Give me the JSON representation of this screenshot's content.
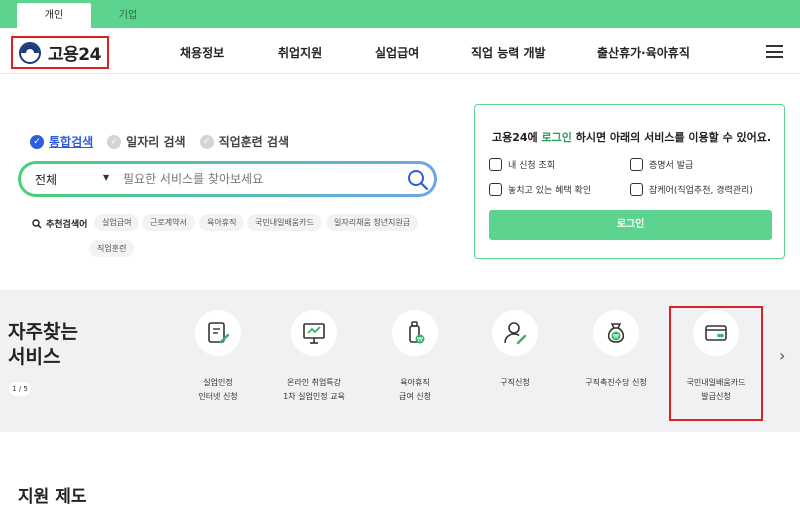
{
  "top_tabs": [
    {
      "label": "개인",
      "active": true
    },
    {
      "label": "기업",
      "active": false
    }
  ],
  "header": {
    "logo_text": "고용24",
    "nav": [
      "채용정보",
      "취업지원",
      "실업급여",
      "직업 능력 개발",
      "출산휴가·육아휴직"
    ],
    "menu_icon": "hamburger-menu-icon"
  },
  "search": {
    "options": [
      {
        "label": "통합검색",
        "checked": true
      },
      {
        "label": "일자리 검색",
        "checked": false
      },
      {
        "label": "직업훈련 검색",
        "checked": false
      }
    ],
    "scope": "전체",
    "placeholder": "필요한 서비스를 찾아보세요",
    "recommended_label": "추천검색어",
    "recommended": [
      "실업급여",
      "근로계약서",
      "육아휴직",
      "국민내일배움카드",
      "일자리채움 청년지원금",
      "직업훈련"
    ]
  },
  "login_panel": {
    "title_pre": "고용24에 ",
    "title_link": "로그인",
    "title_post": " 하시면 아래의 서비스를 이용할 수 있어요.",
    "items": [
      "내 신청 조회",
      "증명서 발급",
      "놓치고 있는 혜택 확인",
      "잡케어(직업추천, 경력관리)"
    ],
    "button": "로그인"
  },
  "faq": {
    "title_line1": "자주찾는",
    "title_line2": "서비스",
    "pager": "1 / 5",
    "services": [
      {
        "label": "실업인정\n인터넷 신청",
        "icon": "document-pen-icon"
      },
      {
        "label": "온라인 취업특강\n1차 실업인정 교육",
        "icon": "presentation-board-icon"
      },
      {
        "label": "육아휴직\n급여 신청",
        "icon": "baby-bottle-icon"
      },
      {
        "label": "구직신청",
        "icon": "person-pen-icon"
      },
      {
        "label": "구직촉진수당 신청",
        "icon": "money-bag-icon"
      },
      {
        "label": "국민내일배움카드\n발급신청",
        "icon": "credit-card-icon"
      }
    ]
  },
  "support": {
    "title": "지원 제도"
  },
  "colors": {
    "brand_green": "#5cd38e",
    "link_blue": "#2f5de0",
    "highlight_red": "#e02020"
  }
}
